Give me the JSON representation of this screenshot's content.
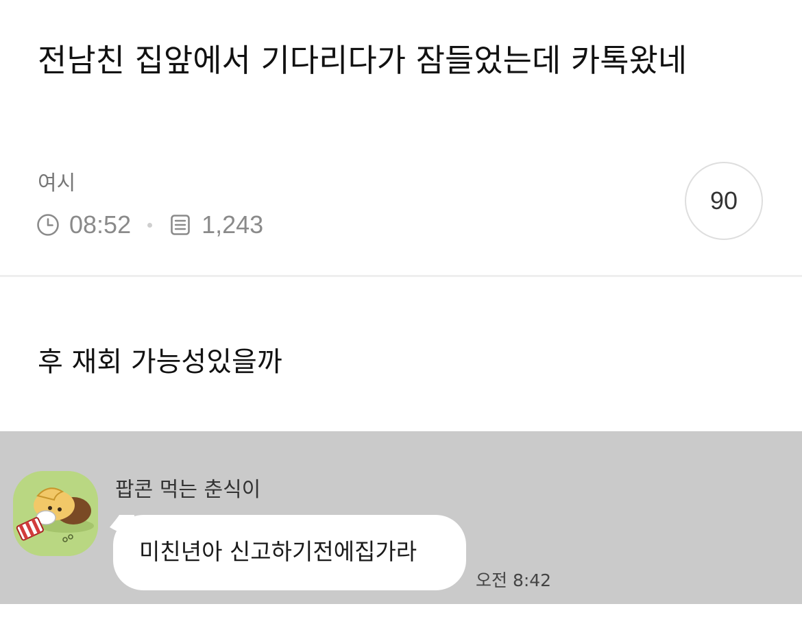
{
  "post": {
    "title": "전남친 집앞에서 기다리다가 잠들었는데 카톡왔네",
    "author": "여시",
    "time": "08:52",
    "views": "1,243",
    "comment_count": "90",
    "body": "후 재회 가능성있을까"
  },
  "chat": {
    "sender_name": "팝콘 먹는 춘식이",
    "message": "미친년아 신고하기전에집가라",
    "timestamp": "오전 8:42",
    "background_color": "#cacaca",
    "bubble_color": "#ffffff"
  },
  "icons": {
    "time": "clock-icon",
    "views": "document-icon"
  }
}
